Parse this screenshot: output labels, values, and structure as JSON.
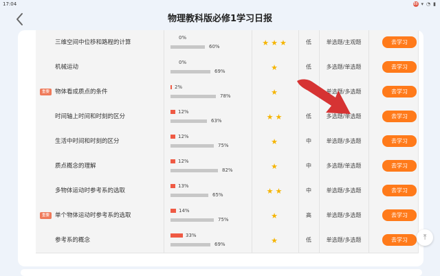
{
  "status_bar": {
    "time": "17:04",
    "badge": "88"
  },
  "header": {
    "title": "物理教科版必修1学习日报"
  },
  "rows": [
    {
      "name": "三维空间中位移和路程的计算",
      "tag": "",
      "progress_a": 0,
      "progress_a_label": "0%",
      "progress_b": 60,
      "progress_b_label": "60%",
      "stars": 3,
      "difficulty": "低",
      "types": "单选题/主观题",
      "action": "去学习"
    },
    {
      "name": "机械运动",
      "tag": "",
      "progress_a": 0,
      "progress_a_label": "0%",
      "progress_b": 69,
      "progress_b_label": "69%",
      "stars": 1,
      "difficulty": "低",
      "types": "多选题/单选题",
      "action": "去学习"
    },
    {
      "name": "物体看成质点的条件",
      "tag": "重要",
      "progress_a": 2,
      "progress_a_label": "2%",
      "progress_b": 78,
      "progress_b_label": "78%",
      "stars": 1,
      "difficulty": "",
      "types": "单选题/多选题",
      "action": "去学习"
    },
    {
      "name": "时间轴上时间和时刻的区分",
      "tag": "",
      "progress_a": 12,
      "progress_a_label": "12%",
      "progress_b": 63,
      "progress_b_label": "63%",
      "stars": 2,
      "difficulty": "低",
      "types": "多选题/单选题",
      "action": "去学习"
    },
    {
      "name": "生活中时间和时刻的区分",
      "tag": "",
      "progress_a": 12,
      "progress_a_label": "12%",
      "progress_b": 75,
      "progress_b_label": "75%",
      "stars": 1,
      "difficulty": "中",
      "types": "单选题/多选题",
      "action": "去学习"
    },
    {
      "name": "质点概念的理解",
      "tag": "",
      "progress_a": 12,
      "progress_a_label": "12%",
      "progress_b": 82,
      "progress_b_label": "82%",
      "stars": 1,
      "difficulty": "中",
      "types": "多选题/单选题",
      "action": "去学习"
    },
    {
      "name": "多物体运动时参考系的选取",
      "tag": "",
      "progress_a": 13,
      "progress_a_label": "13%",
      "progress_b": 65,
      "progress_b_label": "65%",
      "stars": 2,
      "difficulty": "中",
      "types": "单选题/多选题",
      "action": "去学习"
    },
    {
      "name": "单个物体运动时参考系的选取",
      "tag": "重要",
      "progress_a": 14,
      "progress_a_label": "14%",
      "progress_b": 75,
      "progress_b_label": "75%",
      "stars": 1,
      "difficulty": "高",
      "types": "单选题/多选题",
      "action": "去学习"
    },
    {
      "name": "参考系的概念",
      "tag": "",
      "progress_a": 33,
      "progress_a_label": "33%",
      "progress_b": 69,
      "progress_b_label": "69%",
      "stars": 1,
      "difficulty": "低",
      "types": "单选题/多选题",
      "action": "去学习"
    }
  ],
  "colors": {
    "button": "#ff7a1a",
    "star": "#f5b400",
    "progress_red": "#ef5a44",
    "tag": "#ef7a5a"
  },
  "icons": {
    "back": "chevron-left-icon",
    "scroll_top": "arrow-up-icon",
    "overlay": "red-arrow-annotation"
  }
}
